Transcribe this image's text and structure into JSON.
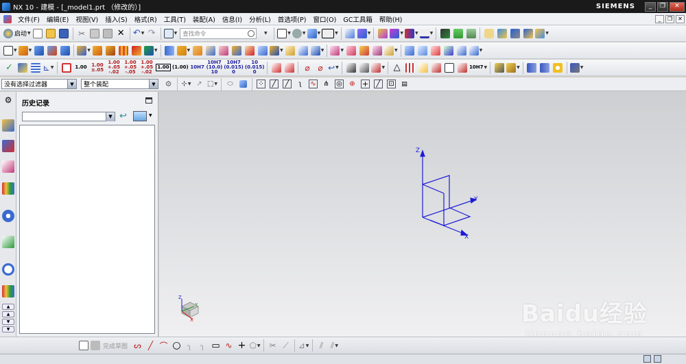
{
  "window": {
    "title": "NX 10 - 建模 - [_model1.prt （修改的）]",
    "brand": "SIEMENS",
    "minimize": "_",
    "restore": "❐",
    "close": "✕"
  },
  "menubar": {
    "items": [
      "文件(F)",
      "编辑(E)",
      "视图(V)",
      "插入(S)",
      "格式(R)",
      "工具(T)",
      "装配(A)",
      "信息(I)",
      "分析(L)",
      "首选项(P)",
      "窗口(O)",
      "GC工具箱",
      "帮助(H)"
    ]
  },
  "toolbar1": {
    "start_label": "启动",
    "search_placeholder": "查找命令"
  },
  "toolbar3": {
    "dim_values": [
      "1.00",
      "1.00\n±.05",
      "1.00\n+.05\n-.02",
      "1.00\n+.05\n-.05",
      "1.00\n+.05\n-.02",
      "1.00",
      "(1.00)",
      "10H7",
      "10H7\n(10.0)\n10",
      "10H7\n(0.015)\n0",
      "10\n(0.015)\n0"
    ],
    "fit_label": "10H7"
  },
  "filterbar": {
    "selection_filter": "没有选择过滤器",
    "scope": "整个装配"
  },
  "history_panel": {
    "title": "历史记录"
  },
  "viewport": {
    "axes": {
      "x": "X",
      "y": "Y",
      "z": "Z"
    },
    "triad": {
      "x": "X",
      "y": "Y",
      "z": "Z"
    }
  },
  "bottombar": {
    "finish_sketch": "完成草图"
  },
  "watermark": {
    "main": "Baidu经验",
    "sub": "jingyan.baidu.com"
  },
  "colors": {
    "axis_blue": "#1b1bd6",
    "triad_red": "#d81b1b",
    "titlebar": "#1a1a1a"
  }
}
